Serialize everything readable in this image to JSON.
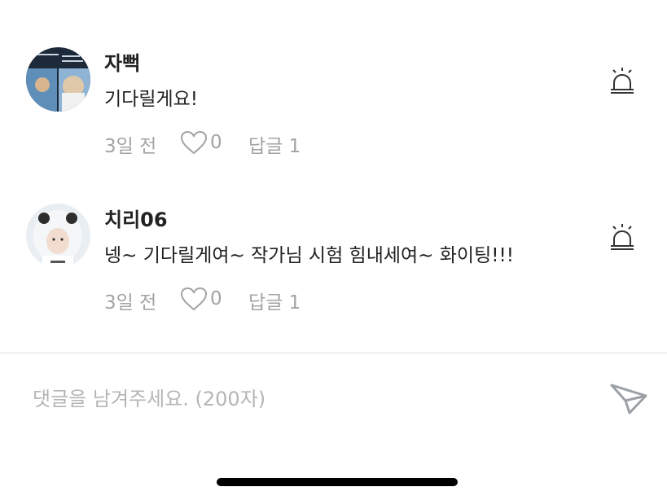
{
  "comments": [
    {
      "username": "자뻑",
      "text": "기다릴게요!",
      "time": "3일 전",
      "likes": "0",
      "reply_label": "답글 1",
      "avatar_icon": "profile-photo-icon",
      "report_icon": "siren-icon",
      "like_icon": "heart-outline-icon"
    },
    {
      "username": "치리06",
      "text": "넹~ 기다릴게여~ 작가님 시험 힘내세여~ 화이팅!!!",
      "time": "3일 전",
      "likes": "0",
      "reply_label": "답글 1",
      "avatar_icon": "profile-photo-icon",
      "report_icon": "siren-icon",
      "like_icon": "heart-outline-icon"
    }
  ],
  "input": {
    "placeholder": "댓글을 남겨주세요. (200자)",
    "value": "",
    "send_icon": "send-icon"
  },
  "colors": {
    "text_primary": "#222222",
    "text_muted": "#a3a3a3",
    "placeholder": "#b5b5b5",
    "divider": "#e2e2e2"
  }
}
